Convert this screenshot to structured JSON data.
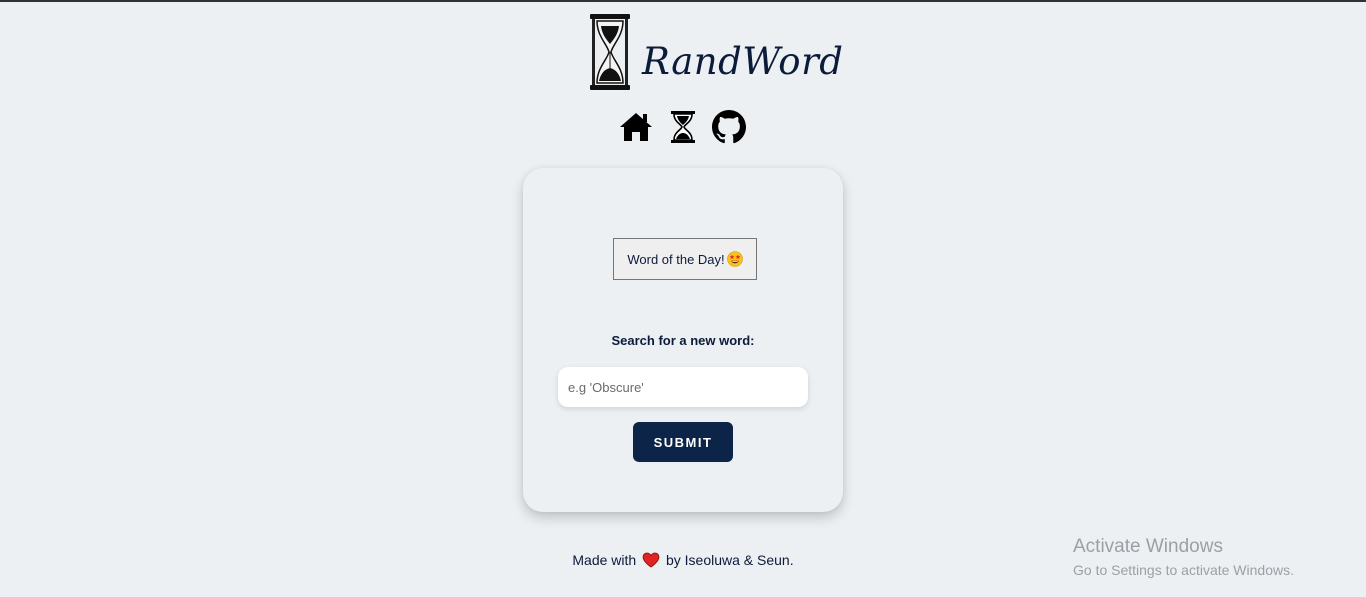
{
  "header": {
    "logo_text": "RandWord",
    "logo_icon": "hourglass-icon"
  },
  "nav": {
    "items": [
      {
        "icon": "home-icon"
      },
      {
        "icon": "hourglass-icon"
      },
      {
        "icon": "github-icon"
      }
    ]
  },
  "card": {
    "word_of_day_label": "Word of the Day!",
    "word_of_day_emoji": "star-struck-emoji-icon",
    "search_label": "Search for a new word:",
    "search_input": {
      "value": "",
      "placeholder": "e.g 'Obscure'"
    },
    "submit_label": "SUBMIT"
  },
  "footer": {
    "prefix": "Made with",
    "suffix": "by Iseoluwa & Seun."
  },
  "watermark": {
    "title": "Activate Windows",
    "subtitle": "Go to Settings to activate Windows."
  },
  "colors": {
    "background": "#ecf0f3",
    "primary": "#0b2447",
    "text": "#0d1b3a",
    "heart": "#e02424"
  }
}
